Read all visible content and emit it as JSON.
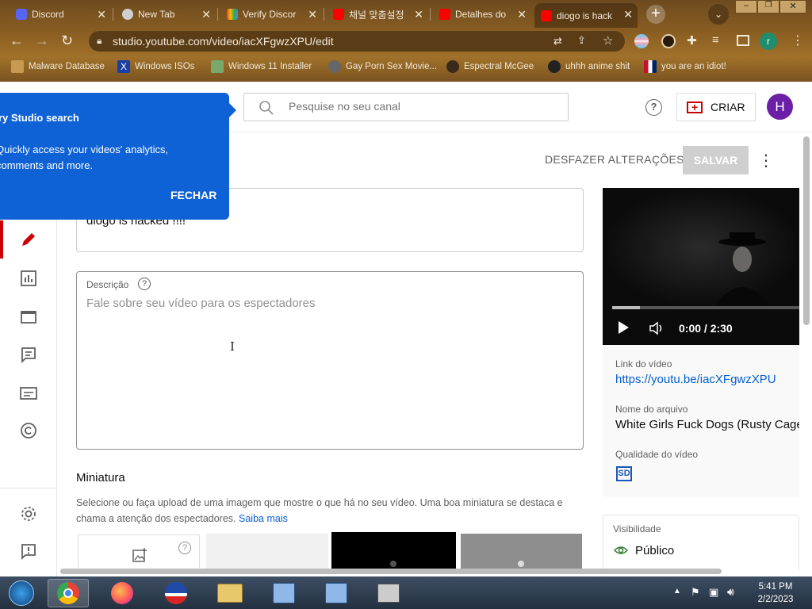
{
  "browser": {
    "tabs": [
      {
        "label": "Discord",
        "color": "#5865f2"
      },
      {
        "label": "New Tab",
        "color": "#cfcfcf"
      },
      {
        "label": "Verify Discor",
        "color": "#e94235"
      },
      {
        "label": "채널 맞춤설정",
        "color": "#ff0000"
      },
      {
        "label": "Detalhes do",
        "color": "#ff0000"
      },
      {
        "label": "diogo is hack",
        "color": "#ff0000"
      }
    ],
    "url": "studio.youtube.com/video/iacXFgwzXPU/edit",
    "profile_initial": "r",
    "bookmarks": [
      "Malware Database",
      "Windows ISOs",
      "Windows 11 Installer",
      "Gay Porn Sex Movie...",
      "Espectral McGee",
      "uhhh anime shit",
      "you are an idiot!"
    ]
  },
  "header": {
    "search_placeholder": "Pesquise no seu canal",
    "help": "?",
    "create_label": "CRIAR",
    "avatar_initial": "H"
  },
  "popup": {
    "title": "ry Studio search",
    "body": "Quickly access your videos' analytics, comments and more.",
    "close_label": "FECHAR"
  },
  "actions": {
    "undo_label": "DESFAZER ALTERAÇÕES",
    "save_label": "SALVAR"
  },
  "form": {
    "title_value": "diogo is hacked !!!!",
    "description_label": "Descrição",
    "description_placeholder": "Fale sobre seu vídeo para os espectadores",
    "thumbnail_heading": "Miniatura",
    "thumbnail_help": "Selecione ou faça upload de uma imagem que mostre o que há no seu vídeo. Uma boa miniatura se destaca e chama a atenção dos espectadores.",
    "learn_more": "Saiba mais"
  },
  "video": {
    "time": "0:00 / 2:30",
    "progress_fraction": 0.15,
    "link_label": "Link do vídeo",
    "link_value": "https://youtu.be/iacXFgwzXPU",
    "filename_label": "Nome do arquivo",
    "filename_value": "White Girls Fuck Dogs (Rusty Cage",
    "quality_label": "Qualidade do vídeo",
    "quality_value": "SD"
  },
  "visibility": {
    "label": "Visibilidade",
    "value": "Público"
  },
  "taskbar": {
    "time": "5:41 PM",
    "date": "2/2/2023"
  }
}
